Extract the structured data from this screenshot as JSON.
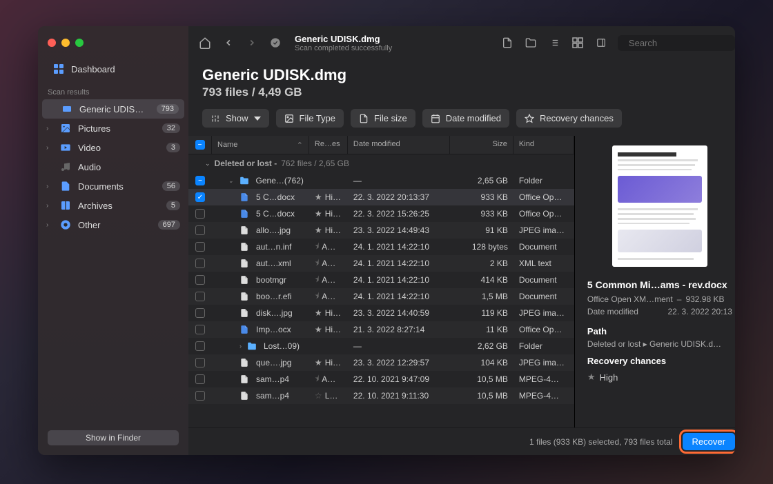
{
  "window": {
    "title": "Generic UDISK.dmg",
    "subtitle": "Scan completed successfully"
  },
  "sidebar": {
    "dashboard": "Dashboard",
    "section": "Scan results",
    "items": [
      {
        "label": "Generic UDISK.d...",
        "badge": "793",
        "active": true,
        "icon": "disk"
      },
      {
        "label": "Pictures",
        "badge": "32",
        "icon": "picture",
        "expandable": true
      },
      {
        "label": "Video",
        "badge": "3",
        "icon": "video",
        "expandable": true
      },
      {
        "label": "Audio",
        "badge": "",
        "icon": "audio"
      },
      {
        "label": "Documents",
        "badge": "56",
        "icon": "doc",
        "expandable": true
      },
      {
        "label": "Archives",
        "badge": "5",
        "icon": "archive",
        "expandable": true
      },
      {
        "label": "Other",
        "badge": "697",
        "icon": "other",
        "expandable": true
      }
    ],
    "show_finder": "Show in Finder"
  },
  "header": {
    "title": "Generic UDISK.dmg",
    "meta": "793 files / 4,49 GB"
  },
  "filters": {
    "show": "Show",
    "filetype": "File Type",
    "filesize": "File size",
    "date": "Date modified",
    "recovery": "Recovery chances"
  },
  "columns": {
    "name": "Name",
    "recovery": "Re…es",
    "date": "Date modified",
    "size": "Size",
    "kind": "Kind"
  },
  "group": {
    "label": "Deleted or lost -",
    "meta": "762 files / 2,65 GB"
  },
  "rows": [
    {
      "name": "Gene…(762)",
      "date": "—",
      "size": "2,65 GB",
      "kind": "Folder",
      "icon": "folder",
      "check": "mixed",
      "indent": 1,
      "expandable": true,
      "expanded": true
    },
    {
      "name": "5 C…docx",
      "rec": "Hi…",
      "date": "22. 3. 2022 20:13:37",
      "size": "933 KB",
      "kind": "Office Op…",
      "icon": "docx",
      "check": "checked",
      "star": true,
      "indent": 2,
      "selected": true
    },
    {
      "name": "5 C…docx",
      "rec": "Hi…",
      "date": "22. 3. 2022 15:26:25",
      "size": "933 KB",
      "kind": "Office Op…",
      "icon": "docx",
      "star": true,
      "indent": 2
    },
    {
      "name": "allo….jpg",
      "rec": "Hi…",
      "date": "23. 3. 2022 14:49:43",
      "size": "91 KB",
      "kind": "JPEG ima…",
      "icon": "file",
      "star": true,
      "indent": 2
    },
    {
      "name": "aut…n.inf",
      "rec": "A…",
      "date": "24. 1. 2021 14:22:10",
      "size": "128 bytes",
      "kind": "Document",
      "icon": "file",
      "halfstar": true,
      "indent": 2
    },
    {
      "name": "aut….xml",
      "rec": "A…",
      "date": "24. 1. 2021 14:22:10",
      "size": "2 KB",
      "kind": "XML text",
      "icon": "file",
      "halfstar": true,
      "indent": 2
    },
    {
      "name": "bootmgr",
      "rec": "A…",
      "date": "24. 1. 2021 14:22:10",
      "size": "414 KB",
      "kind": "Document",
      "icon": "file",
      "halfstar": true,
      "indent": 2
    },
    {
      "name": "boo…r.efi",
      "rec": "A…",
      "date": "24. 1. 2021 14:22:10",
      "size": "1,5 MB",
      "kind": "Document",
      "icon": "file",
      "halfstar": true,
      "indent": 2
    },
    {
      "name": "disk….jpg",
      "rec": "Hi…",
      "date": "23. 3. 2022 14:40:59",
      "size": "119 KB",
      "kind": "JPEG ima…",
      "icon": "file",
      "star": true,
      "indent": 2
    },
    {
      "name": "Imp…ocx",
      "rec": "Hi…",
      "date": "21. 3. 2022 8:27:14",
      "size": "11 KB",
      "kind": "Office Op…",
      "icon": "docx",
      "star": true,
      "indent": 2
    },
    {
      "name": "Lost…09)",
      "date": "—",
      "size": "2,62 GB",
      "kind": "Folder",
      "icon": "folder",
      "indent": 2,
      "expandable": true
    },
    {
      "name": "que….jpg",
      "rec": "Hi…",
      "date": "23. 3. 2022 12:29:57",
      "size": "104 KB",
      "kind": "JPEG ima…",
      "icon": "file",
      "star": true,
      "indent": 2
    },
    {
      "name": "sam…p4",
      "rec": "A…",
      "date": "22. 10. 2021 9:47:09",
      "size": "10,5 MB",
      "kind": "MPEG-4…",
      "icon": "file",
      "halfstar": true,
      "indent": 2
    },
    {
      "name": "sam…p4",
      "rec": "L…",
      "date": "22. 10. 2021 9:11:30",
      "size": "10,5 MB",
      "kind": "MPEG-4…",
      "icon": "file",
      "emptystar": true,
      "indent": 2
    }
  ],
  "details": {
    "filename": "5 Common Mi…ams - rev.docx",
    "kind": "Office Open XM…ment",
    "size": "932.98 KB",
    "date_label": "Date modified",
    "date_value": "22. 3. 2022 20:13",
    "path_label": "Path",
    "path_value": "Deleted or lost ▸ Generic UDISK.d…",
    "chances_label": "Recovery chances",
    "chances_value": "High"
  },
  "footer": {
    "status": "1 files (933 KB) selected, 793 files total",
    "recover": "Recover"
  },
  "search_placeholder": "Search"
}
